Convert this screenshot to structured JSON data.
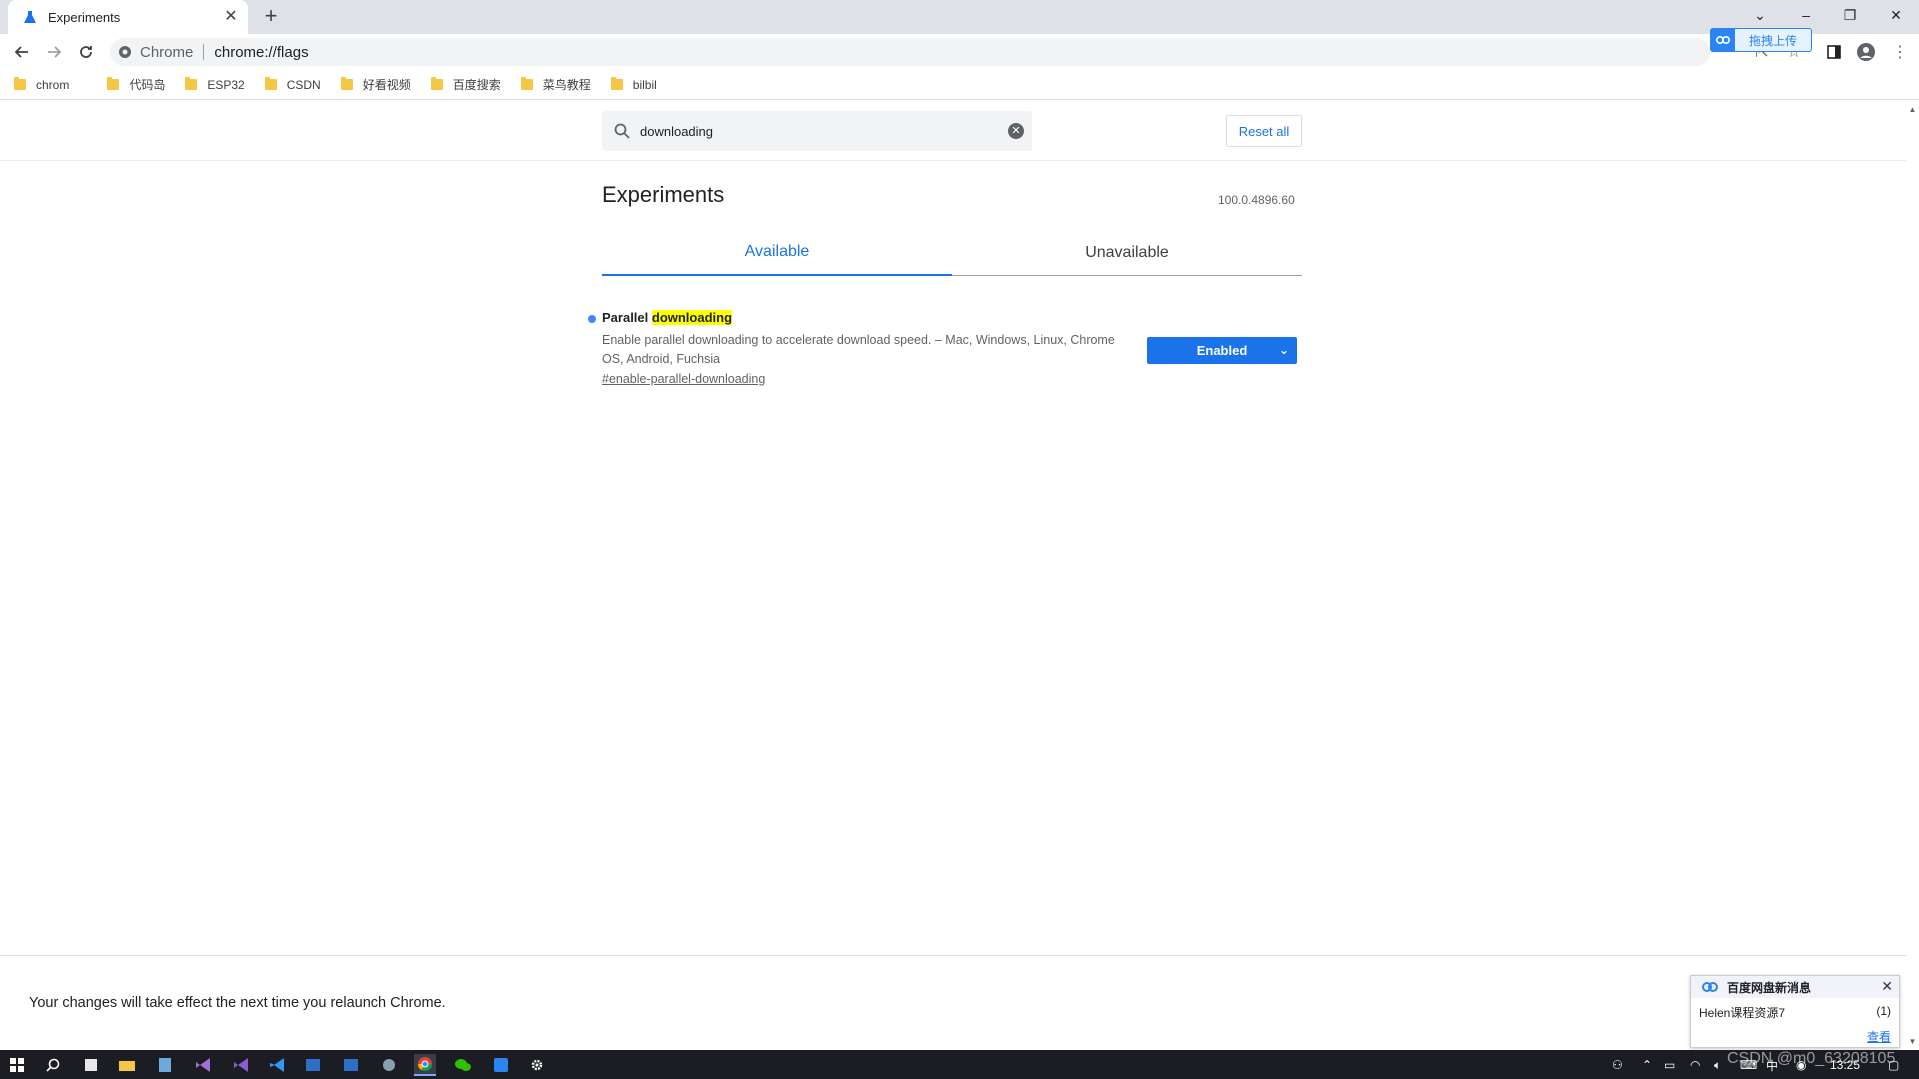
{
  "browser": {
    "tab_title": "Experiments",
    "omnibox_scheme": "Chrome",
    "omnibox_url": "chrome://flags",
    "baidu_upload_label": "拖拽上传"
  },
  "bookmarks": [
    "chrom",
    "代码岛",
    "ESP32",
    "CSDN",
    "好看视频",
    "百度搜索",
    "菜鸟教程",
    "bilbil"
  ],
  "flags_page": {
    "search_value": "downloading",
    "reset_label": "Reset all",
    "title": "Experiments",
    "version": "100.0.4896.60",
    "tabs": [
      {
        "label": "Available",
        "selected": true
      },
      {
        "label": "Unavailable",
        "selected": false
      }
    ],
    "flag": {
      "name_prefix": "Parallel ",
      "name_highlight": "downloading",
      "description": "Enable parallel downloading to accelerate download speed. – Mac, Windows, Linux, Chrome OS, Android, Fuchsia",
      "anchor": "#enable-parallel-downloading",
      "state": "Enabled"
    },
    "relaunch_message": "Your changes will take effect the next time you relaunch Chrome."
  },
  "notification": {
    "title": "百度网盘新消息",
    "item": "Helen课程资源7",
    "count": "(1)",
    "action": "查看"
  },
  "taskbar": {
    "clock": "13:25",
    "watermark": "CSDN @m0_63208105"
  },
  "colors": {
    "accent": "#1a73e8",
    "highlight": "#ffff00",
    "tabstrip": "#dee1e6",
    "taskbar": "#1b1d23"
  }
}
